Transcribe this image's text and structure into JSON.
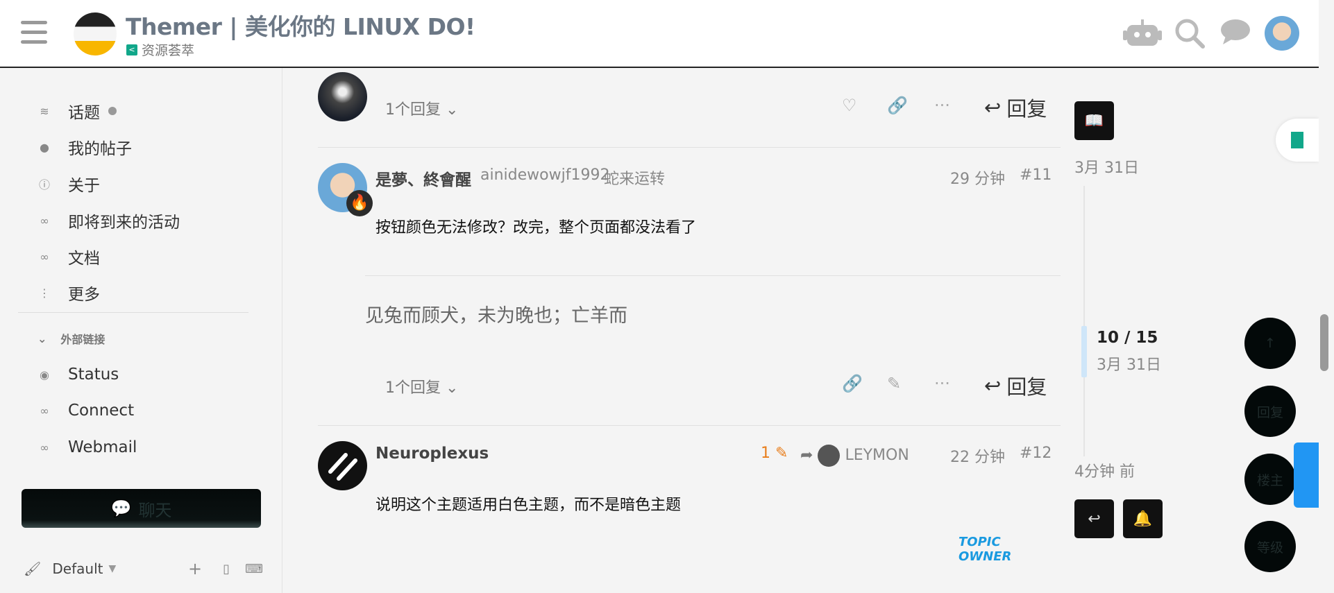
{
  "header": {
    "title": "Themer | 美化你的 LINUX DO!",
    "category": "资源荟萃",
    "icons": [
      "robot-icon",
      "search-icon",
      "chat-bubble-icon",
      "user-avatar"
    ]
  },
  "sidebar": {
    "items": [
      {
        "label": "话题",
        "icon": "layers-icon"
      },
      {
        "label": "我的帖子",
        "icon": "user-icon"
      },
      {
        "label": "关于",
        "icon": "info-icon"
      },
      {
        "label": "即将到来的活动",
        "icon": "link-icon"
      },
      {
        "label": "文档",
        "icon": "link-icon"
      },
      {
        "label": "更多",
        "icon": "more-vertical-icon"
      }
    ],
    "group_title": "外部链接",
    "external_links": [
      {
        "label": "Status",
        "icon": "eye-icon"
      },
      {
        "label": "Connect",
        "icon": "link-icon"
      },
      {
        "label": "Webmail",
        "icon": "link-icon"
      }
    ],
    "chat_label": "聊天",
    "theme_label": "Default"
  },
  "posts": {
    "top_actions": {
      "replies": "1个回复",
      "reply": "回复"
    },
    "post11": {
      "username": "是夢、終會醒",
      "handle": "ainidewowjf1992",
      "title": "蛇来运转",
      "time": "29 分钟",
      "number": "#11",
      "body": "按钮颜色无法修改？改完，整个页面都没法看了",
      "quote": "见兔而顾犬，未为晚也；亡羊而",
      "replies": "1个回复",
      "reply": "回复"
    },
    "post12": {
      "username": "Neuroplexus",
      "edits": "1",
      "reply_to": "LEYMON",
      "time": "22 分钟",
      "number": "#12",
      "body": "说明这个主题适用白色主题，而不是暗色主题",
      "badge": "TOPIC OWNER"
    }
  },
  "timeline": {
    "start_date": "3月 31日",
    "position": "10 / 15",
    "position_date": "3月 31日",
    "end_label": "4分钟 前"
  },
  "fabs": {
    "up": "↑",
    "reply": "回复",
    "owner": "楼主",
    "level": "等级"
  },
  "colors": {
    "accent": "#11a78a",
    "link_blue": "#1a9ae0",
    "edit_orange": "#e87d1a"
  }
}
